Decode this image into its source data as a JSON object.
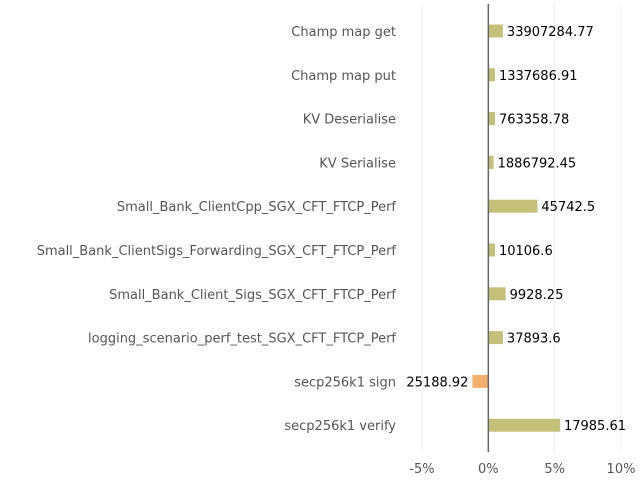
{
  "chart_data": {
    "type": "bar",
    "orientation": "horizontal",
    "categories": [
      "Champ map get",
      "Champ map put",
      "KV Deserialise",
      "KV Serialise",
      "Small_Bank_ClientCpp_SGX_CFT_FTCP_Perf",
      "Small_Bank_ClientSigs_Forwarding_SGX_CFT_FTCP_Perf",
      "Small_Bank_Client_Sigs_SGX_CFT_FTCP_Perf",
      "logging_scenario_perf_test_SGX_CFT_FTCP_Perf",
      "secp256k1 sign",
      "secp256k1 verify"
    ],
    "values": [
      1.1,
      0.5,
      0.5,
      0.4,
      3.7,
      0.5,
      1.3,
      1.1,
      -1.2,
      5.4
    ],
    "data_labels": [
      "33907284.77",
      "1337686.91",
      "763358.78",
      "1886792.45",
      "45742.5",
      "10106.6",
      "9928.25",
      "37893.6",
      "25188.92",
      "17985.61"
    ],
    "xlim": [
      -5,
      10
    ],
    "xticks": [
      -5,
      0,
      5,
      10
    ],
    "xtick_labels": [
      "-5%",
      "0%",
      "5%",
      "10%"
    ],
    "title": "",
    "xlabel": "",
    "ylabel": "",
    "grid": "vertical",
    "legend": "none",
    "colors": {
      "positive": "#c4c07a",
      "negative": "#f4ae6c",
      "zero_line": "#666666",
      "grid": "#eeeeee",
      "label_text": "#555555",
      "value_text": "#000000"
    }
  }
}
